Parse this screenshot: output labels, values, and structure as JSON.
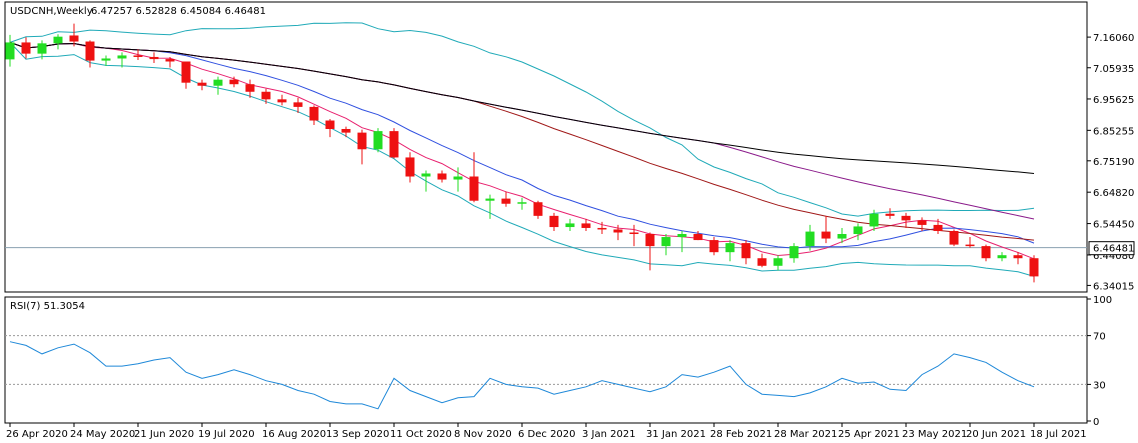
{
  "header": {
    "symbol_title": "USDCNH,Weekly",
    "ohlc_text": "6.47257 6.52828 6.45084 6.46481"
  },
  "indicator": {
    "title": "RSI(7) 51.3054"
  },
  "colors": {
    "bull": "#22dd22",
    "bear": "#ee1111",
    "rsi_line": "#1e88d8",
    "bb": "#20aab8",
    "ma_fast": "#e8206e",
    "ma_mid": "#3050e0",
    "ma_slow": "#a01818",
    "ma_slower": "#8a1a8a",
    "ma_long": "#000000",
    "price_line": "#8aa0b0"
  },
  "chart_data": {
    "type": "candlestick",
    "symbol": "USDCNH",
    "timeframe": "Weekly",
    "last_price": 6.46481,
    "last_price_label": "6.46481",
    "price_axis_ticks": [
      "7.16060",
      "7.05935",
      "6.95625",
      "6.85255",
      "6.75190",
      "6.64820",
      "6.54450",
      "6.44080",
      "6.34015"
    ],
    "price_axis_values": [
      7.1606,
      7.05935,
      6.95625,
      6.85255,
      6.7519,
      6.6482,
      6.5445,
      6.4408,
      6.34015
    ],
    "ylim": [
      6.325,
      7.27
    ],
    "x_labels": [
      "26 Apr 2020",
      "24 May 2020",
      "21 Jun 2020",
      "19 Jul 2020",
      "16 Aug 2020",
      "13 Sep 2020",
      "11 Oct 2020",
      "8 Nov 2020",
      "6 Dec 2020",
      "3 Jan 2021",
      "31 Jan 2021",
      "28 Feb 2021",
      "28 Mar 2021",
      "25 Apr 2021",
      "23 May 2021",
      "20 Jun 2021",
      "18 Jul 2021"
    ],
    "x_label_index": [
      0,
      4,
      8,
      12,
      16,
      20,
      24,
      28,
      32,
      36,
      40,
      44,
      48,
      52,
      56,
      60,
      64
    ],
    "candles": [
      [
        7.087,
        7.168,
        7.063,
        7.143
      ],
      [
        7.143,
        7.16,
        7.09,
        7.106
      ],
      [
        7.106,
        7.15,
        7.087,
        7.14
      ],
      [
        7.14,
        7.17,
        7.12,
        7.162
      ],
      [
        7.166,
        7.205,
        7.13,
        7.146
      ],
      [
        7.146,
        7.15,
        7.06,
        7.083
      ],
      [
        7.083,
        7.1,
        7.065,
        7.09
      ],
      [
        7.09,
        7.11,
        7.06,
        7.1
      ],
      [
        7.1,
        7.12,
        7.085,
        7.095
      ],
      [
        7.095,
        7.11,
        7.075,
        7.088
      ],
      [
        7.088,
        7.095,
        7.06,
        7.08
      ],
      [
        7.08,
        7.08,
        6.99,
        7.01
      ],
      [
        7.01,
        7.02,
        6.985,
        7.0
      ],
      [
        7.0,
        7.03,
        6.97,
        7.02
      ],
      [
        7.02,
        7.03,
        6.995,
        7.005
      ],
      [
        7.005,
        7.02,
        6.96,
        6.98
      ],
      [
        6.98,
        6.99,
        6.94,
        6.955
      ],
      [
        6.955,
        6.97,
        6.935,
        6.945
      ],
      [
        6.945,
        6.96,
        6.91,
        6.93
      ],
      [
        6.93,
        6.935,
        6.87,
        6.885
      ],
      [
        6.885,
        6.89,
        6.83,
        6.857
      ],
      [
        6.857,
        6.865,
        6.83,
        6.845
      ],
      [
        6.845,
        6.855,
        6.74,
        6.79
      ],
      [
        6.79,
        6.86,
        6.78,
        6.85
      ],
      [
        6.85,
        6.86,
        6.76,
        6.763
      ],
      [
        6.763,
        6.78,
        6.68,
        6.7
      ],
      [
        6.7,
        6.72,
        6.65,
        6.71
      ],
      [
        6.71,
        6.72,
        6.68,
        6.69
      ],
      [
        6.69,
        6.73,
        6.65,
        6.7
      ],
      [
        6.7,
        6.78,
        6.615,
        6.62
      ],
      [
        6.62,
        6.64,
        6.56,
        6.627
      ],
      [
        6.627,
        6.65,
        6.6,
        6.61
      ],
      [
        6.61,
        6.63,
        6.59,
        6.615
      ],
      [
        6.615,
        6.62,
        6.56,
        6.57
      ],
      [
        6.57,
        6.58,
        6.52,
        6.533
      ],
      [
        6.533,
        6.56,
        6.52,
        6.545
      ],
      [
        6.545,
        6.56,
        6.52,
        6.53
      ],
      [
        6.53,
        6.55,
        6.51,
        6.525
      ],
      [
        6.525,
        6.54,
        6.49,
        6.515
      ],
      [
        6.515,
        6.54,
        6.47,
        6.51
      ],
      [
        6.51,
        6.515,
        6.39,
        6.47
      ],
      [
        6.47,
        6.51,
        6.44,
        6.5
      ],
      [
        6.5,
        6.52,
        6.45,
        6.51
      ],
      [
        6.51,
        6.52,
        6.49,
        6.49
      ],
      [
        6.49,
        6.5,
        6.44,
        6.45
      ],
      [
        6.45,
        6.49,
        6.42,
        6.48
      ],
      [
        6.48,
        6.49,
        6.41,
        6.43
      ],
      [
        6.43,
        6.445,
        6.4,
        6.405
      ],
      [
        6.405,
        6.44,
        6.39,
        6.43
      ],
      [
        6.43,
        6.48,
        6.415,
        6.47
      ],
      [
        6.47,
        6.54,
        6.455,
        6.518
      ],
      [
        6.518,
        6.57,
        6.48,
        6.495
      ],
      [
        6.495,
        6.53,
        6.48,
        6.51
      ],
      [
        6.51,
        6.545,
        6.49,
        6.535
      ],
      [
        6.535,
        6.59,
        6.52,
        6.577
      ],
      [
        6.577,
        6.595,
        6.56,
        6.57
      ],
      [
        6.57,
        6.58,
        6.53,
        6.555
      ],
      [
        6.555,
        6.565,
        6.52,
        6.54
      ],
      [
        6.54,
        6.56,
        6.51,
        6.52
      ],
      [
        6.52,
        6.525,
        6.47,
        6.475
      ],
      [
        6.475,
        6.5,
        6.465,
        6.47
      ],
      [
        6.47,
        6.475,
        6.42,
        6.43
      ],
      [
        6.43,
        6.45,
        6.42,
        6.44
      ],
      [
        6.44,
        6.45,
        6.41,
        6.43
      ],
      [
        6.43,
        6.44,
        6.35,
        6.37
      ]
    ],
    "rsi": {
      "period": 7,
      "last_value": 51.3054,
      "title": "RSI(7) 51.3054",
      "levels": [
        70,
        30
      ],
      "axis_ticks": [
        "100",
        "70",
        "30",
        "0"
      ],
      "ylim": [
        0,
        100
      ],
      "values": [
        65,
        62,
        55,
        60,
        63,
        56,
        45,
        45,
        47,
        50,
        52,
        40,
        35,
        38,
        42,
        38,
        33,
        30,
        25,
        22,
        16,
        14,
        14,
        10,
        35,
        25,
        20,
        15,
        19,
        20,
        35,
        30,
        28,
        27,
        22,
        25,
        28,
        33,
        30,
        27,
        24,
        28,
        38,
        36,
        40,
        45,
        30,
        22,
        21,
        20,
        23,
        28,
        35,
        31,
        32,
        26,
        25,
        38,
        45,
        55,
        52,
        48,
        40,
        33,
        28
      ]
    }
  }
}
